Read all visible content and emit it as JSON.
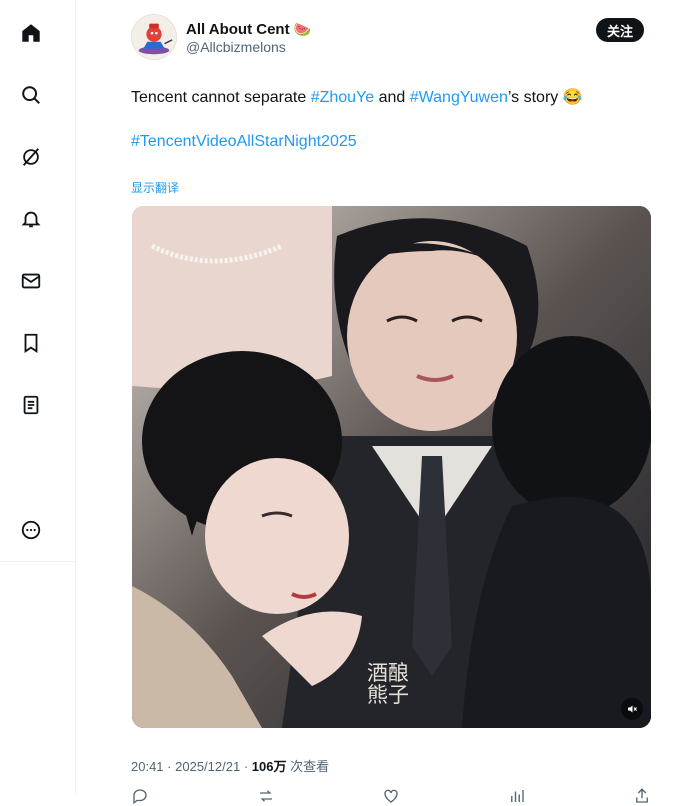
{
  "sidebar": {
    "items": [
      {
        "icon": "home-icon"
      },
      {
        "icon": "search-icon"
      },
      {
        "icon": "grok-icon"
      },
      {
        "icon": "bell-icon"
      },
      {
        "icon": "mail-icon"
      },
      {
        "icon": "bookmark-icon"
      },
      {
        "icon": "list-icon"
      },
      {
        "icon": "more-icon"
      }
    ]
  },
  "author": {
    "display_name": "All About Cent",
    "name_emoji": "🍉",
    "handle": "@Allcbizmelons"
  },
  "follow_button": {
    "label": "关注"
  },
  "tweet": {
    "text_before": "Tencent cannot separate ",
    "hashtag_1": "#ZhouYe",
    "text_mid": " and ",
    "hashtag_2": "#WangYuwen",
    "text_after": "’s story",
    "emoji": "😂",
    "hashtag_line": "#TencentVideoAllStarNight2025",
    "translate_label": "显示翻译"
  },
  "media": {
    "watermark_line1": "酒酿",
    "watermark_line2": "熊子"
  },
  "meta": {
    "time": "20:41",
    "date": "2025/12/21",
    "views": "106万",
    "views_label": "次查看"
  },
  "colors": {
    "link": "#1d9bf0",
    "text": "#0f1419",
    "secondary": "#536471",
    "follow_bg": "#0f1419"
  }
}
